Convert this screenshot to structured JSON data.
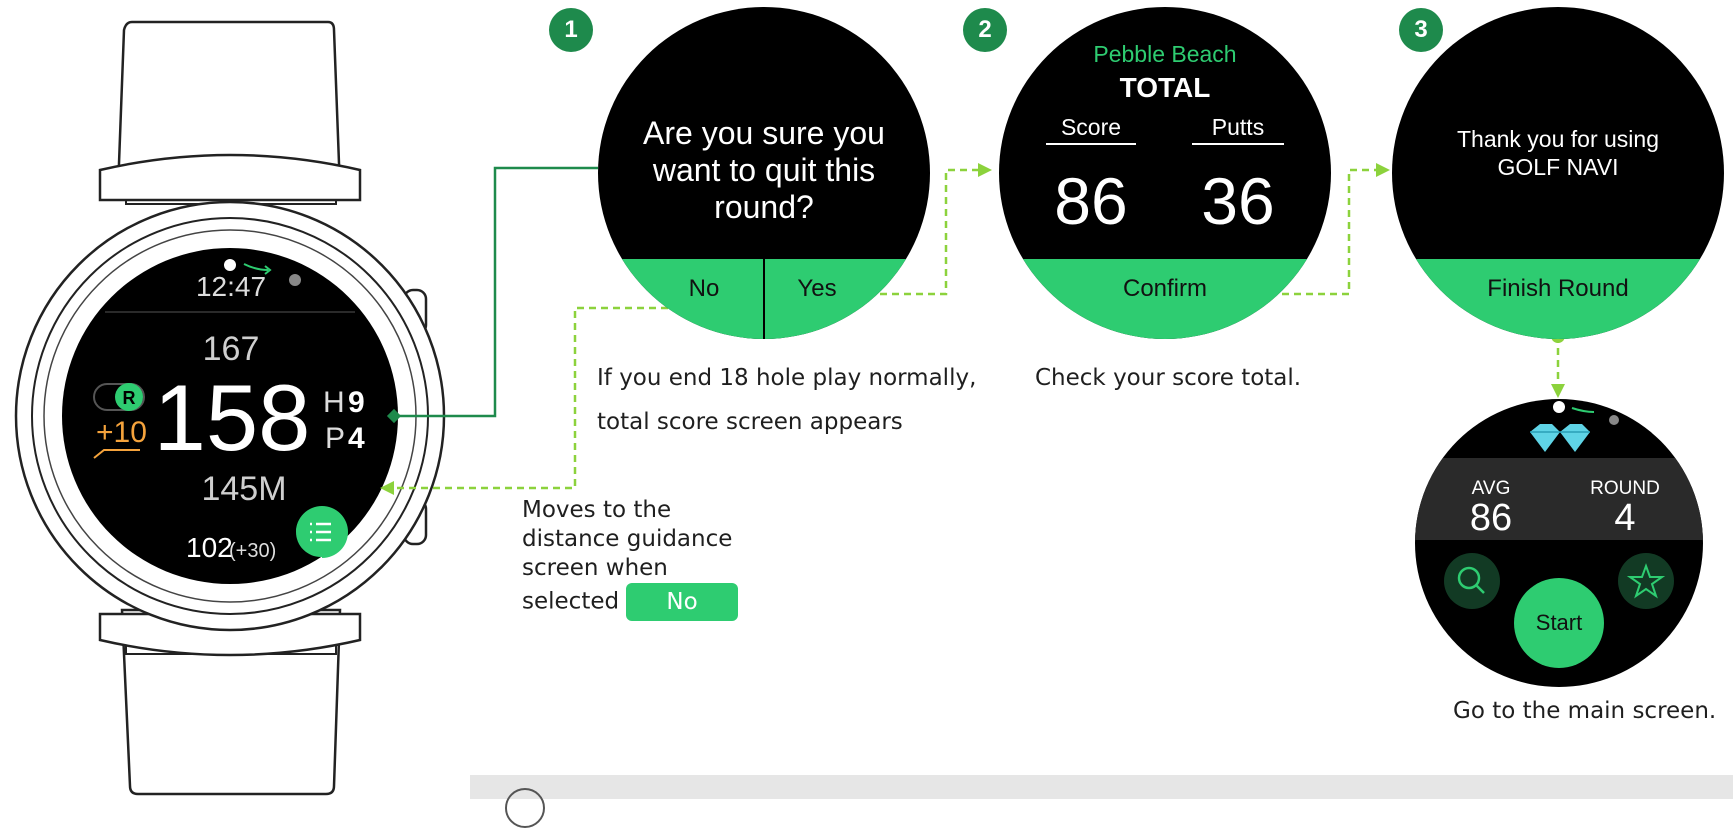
{
  "colors": {
    "accent": "#2ecc71",
    "dark_green": "#1e8a4c",
    "orange": "#f5a33c",
    "connector": "#8cd23c"
  },
  "watch": {
    "time": "12:47",
    "front_distance": "167",
    "center_distance": "158",
    "back_distance": "145M",
    "hole_label": "H",
    "hole_number": "9",
    "par_label": "P",
    "par_number": "4",
    "r_badge": "R",
    "score_diff": "+10",
    "shot_distance": "102",
    "shot_extra": "(+30)",
    "menu_icon": "list-icon"
  },
  "steps": [
    {
      "number": "1",
      "screen": {
        "question": [
          "Are you sure you",
          "want to quit this",
          "round?"
        ],
        "no_label": "No",
        "yes_label": "Yes"
      },
      "caption": [
        "If you end 18 hole play normally,",
        "total score screen appears"
      ]
    },
    {
      "number": "2",
      "screen": {
        "course": "Pebble Beach",
        "heading": "TOTAL",
        "score_label": "Score",
        "score_value": "86",
        "putts_label": "Putts",
        "putts_value": "36",
        "confirm_label": "Confirm"
      },
      "caption": [
        "Check your score total."
      ]
    },
    {
      "number": "3",
      "screen": {
        "message": [
          "Thank you for using",
          "GOLF NAVI"
        ],
        "finish_label": "Finish Round"
      },
      "caption": [
        "Go to the main screen."
      ]
    }
  ],
  "main_screen": {
    "avg_label": "AVG",
    "avg_value": "86",
    "round_label": "ROUND",
    "round_value": "4",
    "start_label": "Start",
    "left_icon": "search-icon",
    "right_icon": "star-icon",
    "badge_icon": "diamond-icon"
  },
  "no_note": {
    "lines": [
      "Moves to the",
      "distance guidance",
      "screen when",
      "selected"
    ],
    "button_label": "No"
  }
}
